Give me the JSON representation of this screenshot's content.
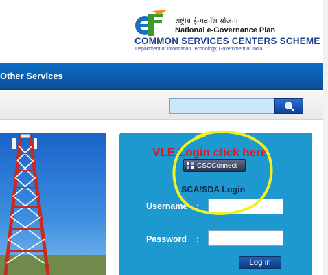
{
  "header": {
    "hindi_title": "राष्ट्रीय ई-गवर्नेंस योजना",
    "plan_name": "National e-Governance Plan",
    "scheme_title": "COMMON SERVICES CENTERS SCHEME",
    "department": "Department of Information Technology, Government of India",
    "logo_text": "eG"
  },
  "nav": {
    "other_services": "Other Services"
  },
  "search": {
    "value": "",
    "placeholder": ""
  },
  "login_panel": {
    "vle_prompt": "VLE Login click here",
    "csc_connect_label": "CSCConnect",
    "section_title": "SCA/SDA Login",
    "username_label": "Username",
    "password_label": "Password",
    "colon": ":",
    "username_value": "",
    "password_value": "",
    "login_button": "Log in"
  },
  "icons": {
    "search": "magnifier-icon",
    "csc_connect": "connect-icon",
    "logo": "egov-logo-icon"
  },
  "colors": {
    "nav_blue": "#0a4e98",
    "panel_blue": "#1d99cf",
    "vle_red": "#e2141a",
    "annotation_yellow": "#f2f01d",
    "search_bg": "#cbe7fb",
    "title_blue": "#1b3f8f"
  }
}
